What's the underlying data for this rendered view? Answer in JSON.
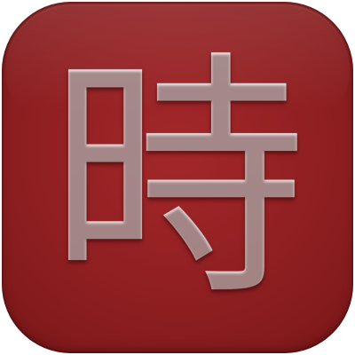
{
  "icon": {
    "glyph": "時",
    "background_color": "#8f1f21",
    "glyph_color": "#f6e6e4"
  }
}
